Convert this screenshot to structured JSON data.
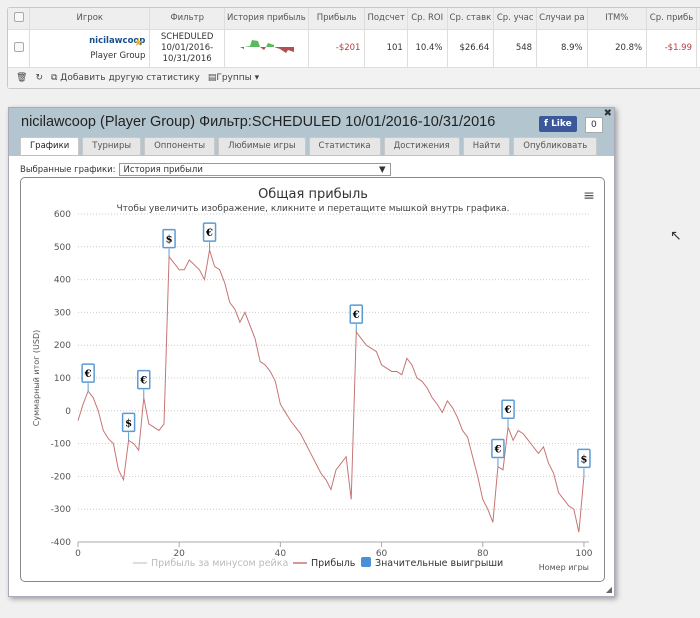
{
  "table": {
    "headers": [
      "Игрок",
      "Фильтр",
      "История прибыль",
      "Прибыль",
      "Подсчет",
      "Ср. ROI",
      "Ср. ставк",
      "Ср. учас",
      "Случаи ра",
      "ITM%",
      "Ср. прибь"
    ],
    "row": {
      "player": "nicilawcoop",
      "group": "Player Group",
      "filter": [
        "SCHEDULED",
        "10/01/2016-",
        "10/31/2016"
      ],
      "profit": "-$201",
      "count": "101",
      "roi": "10.4%",
      "stake": "$26.64",
      "entrants": "548",
      "cases": "8.9%",
      "itm": "20.8%",
      "avg_profit": "-$1.99"
    },
    "toolbar": {
      "add_stat": "Добавить другую статистику",
      "groups": "Группы"
    }
  },
  "window": {
    "title": "nicilawcoop (Player Group) Фильтр:SCHEDULED 10/01/2016-10/31/2016",
    "like": "Like",
    "like_count": "0",
    "tabs": [
      "Графики",
      "Турниры",
      "Оппоненты",
      "Любимые игры",
      "Статистика",
      "Достижения",
      "Найти",
      "Опубликовать"
    ],
    "select_label": "Выбранные графики:",
    "select_value": "История прибыли"
  },
  "chart_data": {
    "type": "line",
    "title": "Общая прибыль",
    "subtitle": "Чтобы увеличить изображение, кликните и перетащите мышкой внутрь графика.",
    "xlabel": "Номер игры",
    "ylabel": "Суммарный итог (USD)",
    "xlim": [
      0,
      101
    ],
    "ylim": [
      -400,
      600
    ],
    "xticks": [
      0,
      20,
      40,
      60,
      80,
      100
    ],
    "yticks": [
      600,
      500,
      400,
      300,
      200,
      100,
      0,
      -100,
      -200,
      -300,
      -400
    ],
    "legend": [
      "Прибыль за минусом рейка",
      "Прибыль",
      "Значительные выигрыши"
    ],
    "legend_position": "bottom",
    "series_color": "#c87474",
    "y": [
      -30,
      20,
      60,
      40,
      0,
      -60,
      -85,
      -100,
      -180,
      -210,
      -90,
      -100,
      -120,
      40,
      -40,
      -50,
      -60,
      -40,
      470,
      450,
      430,
      430,
      460,
      445,
      430,
      400,
      490,
      440,
      430,
      390,
      330,
      310,
      270,
      300,
      260,
      220,
      150,
      140,
      120,
      90,
      20,
      -5,
      -30,
      -50,
      -70,
      -100,
      -130,
      -160,
      -190,
      -210,
      -240,
      -180,
      -160,
      -140,
      -270,
      240,
      220,
      200,
      190,
      180,
      140,
      130,
      120,
      120,
      110,
      160,
      140,
      100,
      90,
      70,
      40,
      20,
      -5,
      30,
      10,
      -20,
      -60,
      -80,
      -140,
      -200,
      -270,
      -300,
      -340,
      -170,
      -180,
      -50,
      -90,
      -60,
      -70,
      -90,
      -110,
      -130,
      -110,
      -160,
      -190,
      -250,
      -270,
      -290,
      -300,
      -370,
      -200
    ],
    "markers": [
      {
        "x": 2,
        "symbol": "€"
      },
      {
        "x": 10,
        "symbol": "$"
      },
      {
        "x": 13,
        "symbol": "€"
      },
      {
        "x": 18,
        "symbol": "$"
      },
      {
        "x": 26,
        "symbol": "€"
      },
      {
        "x": 55,
        "symbol": "€"
      },
      {
        "x": 83,
        "symbol": "€"
      },
      {
        "x": 85,
        "symbol": "€"
      },
      {
        "x": 100,
        "symbol": "$"
      }
    ]
  }
}
